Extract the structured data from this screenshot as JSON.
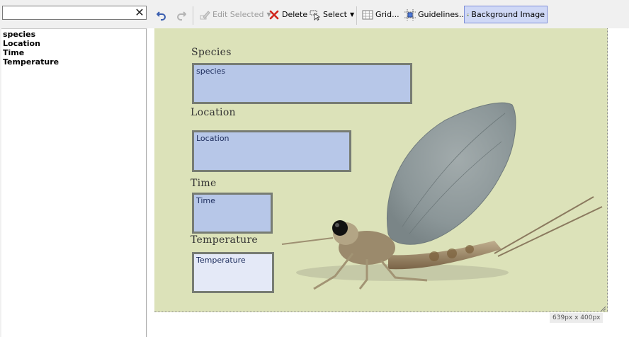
{
  "search": {
    "value": "",
    "placeholder": ""
  },
  "field_list": [
    "species",
    "Location",
    "Time",
    "Temperature"
  ],
  "toolbar": {
    "edit_selected": "Edit Selected",
    "delete": "Delete",
    "select": "Select",
    "grid": "Grid...",
    "guidelines": "Guidelines...",
    "background_image": "Background Image"
  },
  "canvas": {
    "labels": {
      "species": "Species",
      "location": "Location",
      "time": "Time",
      "temperature": "Temperature"
    },
    "boxes": {
      "species": "species",
      "location": "Location",
      "time": "Time",
      "temperature": "Temperature"
    },
    "dimensions": "639px x 400px"
  },
  "colors": {
    "canvas_bg": "#dce2b9",
    "field_fill": "#b7c7e8",
    "field_selected_fill": "#e4e9f7",
    "active_toggle": "#cfd8f6"
  }
}
